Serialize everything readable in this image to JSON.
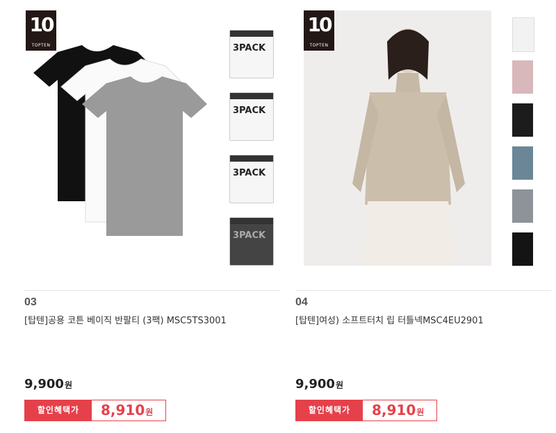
{
  "brand": {
    "logo_number": "10",
    "logo_text": "TOPTEN"
  },
  "products": [
    {
      "number": "03",
      "name": "[탑텐]공용 코튼 베이직 반팔티 (3팩) MSC5TS3001",
      "price": "9,900",
      "currency": "원",
      "discount_label": "할인혜택가",
      "discount_price": "8,910",
      "pack_label": "3PACK"
    },
    {
      "number": "04",
      "name": "[탑텐]여성) 소프트터치 립 터틀넥MSC4EU2901",
      "price": "9,900",
      "currency": "원",
      "discount_label": "할인혜택가",
      "discount_price": "8,910",
      "swatch_colors": [
        "#f2f2f2",
        "#d9b8bc",
        "#1c1c1c",
        "#6b8797",
        "#8e9299",
        "#141414"
      ]
    }
  ],
  "colors": {
    "accent": "#e5414b",
    "brand_bg": "#231815"
  }
}
